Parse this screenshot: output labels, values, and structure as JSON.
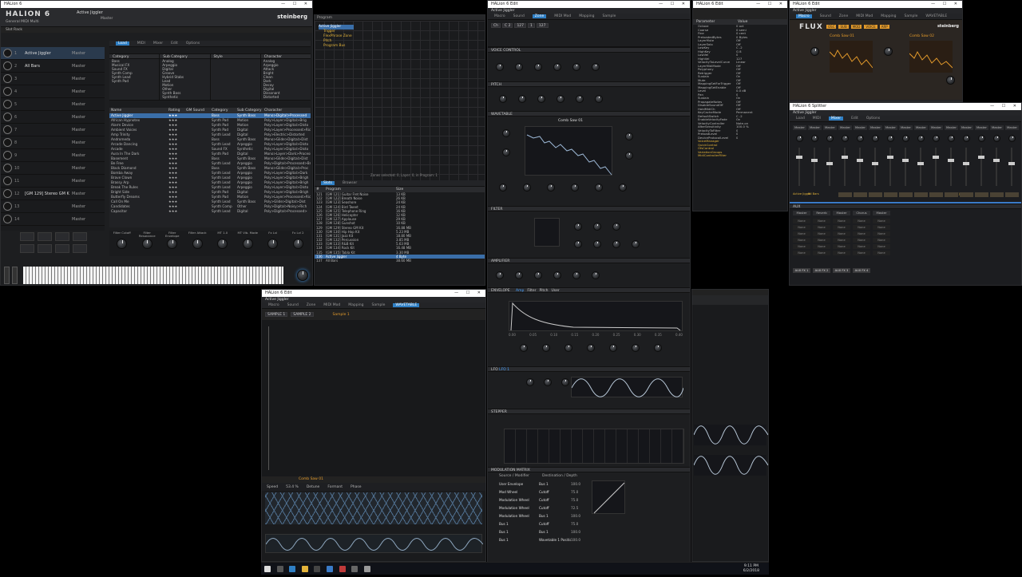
{
  "main": {
    "title": "HALion 6",
    "menu": [
      "Active Jiggler",
      "Master",
      "General MIDI Multi"
    ],
    "brand": "steinberg",
    "logo": "HALION 6",
    "slot_rack_label": "Slot Rack",
    "slots": [
      {
        "num": "1",
        "name": "Active Jiggler"
      },
      {
        "num": "2",
        "name": "All Bars"
      },
      {
        "num": "3",
        "name": ""
      },
      {
        "num": "4",
        "name": ""
      },
      {
        "num": "5",
        "name": ""
      },
      {
        "num": "6",
        "name": ""
      },
      {
        "num": "7",
        "name": ""
      },
      {
        "num": "8",
        "name": ""
      },
      {
        "num": "9",
        "name": ""
      },
      {
        "num": "10",
        "name": ""
      },
      {
        "num": "11",
        "name": ""
      },
      {
        "num": "12",
        "name": "[GM 129] Stereo GM Kit"
      },
      {
        "num": "13",
        "name": ""
      },
      {
        "num": "14",
        "name": ""
      }
    ],
    "output_label": "Master",
    "browser_tabs": [
      "Load",
      "MIDI",
      "Mixer",
      "Edit",
      "Options"
    ],
    "filter_headers": [
      "Category",
      "Sub Category",
      "Style",
      "Character"
    ],
    "categories": [
      "Bass",
      "Musical FX",
      "Sound FX",
      "Synth Comp",
      "Synth Lead",
      "Synth Pad"
    ],
    "subcategories": [
      "Analog",
      "Arpeggio",
      "Digital",
      "Groove",
      "Hybrid Stabs",
      "Lead",
      "Motion",
      "Other",
      "Synth Bass",
      "Synthetic"
    ],
    "character": [
      "Analog",
      "Arpeggio",
      "Attack",
      "Bright",
      "Clean",
      "Dark",
      "Decay",
      "Digital",
      "Dissonant",
      "Distorted"
    ],
    "result_headers": [
      "Name",
      "Rating",
      "GM Sound",
      "Category",
      "Sub Category",
      "Character"
    ],
    "results": [
      [
        "Active Jiggler",
        "★★★",
        "",
        "Bass",
        "Synth Bass",
        "Mono>Digital>Processed"
      ],
      [
        "African Hypnotex",
        "★★★",
        "",
        "Synth Pad",
        "Motion",
        "Poly>Layer>Digital>Brig"
      ],
      [
        "Alarm Device",
        "★★★",
        "",
        "Synth Pad",
        "Motion",
        "Poly>Layer>Digital>Disto"
      ],
      [
        "Ambient Voices",
        "★★★",
        "",
        "Synth Pad",
        "Digital",
        "Poly>Layer>Processed>Rich"
      ],
      [
        "Amp Trinity",
        "★★★",
        "",
        "Synth Lead",
        "Digital",
        "Poly>Electric>Distorted"
      ],
      [
        "Andromeda",
        "★★★",
        "",
        "Bass",
        "Synth Bass",
        "Mono>Glide>Digital>Dist"
      ],
      [
        "Arcade Dancing",
        "★★★",
        "",
        "Synth Lead",
        "Arpeggio",
        "Poly>Layer>Digital>Disto"
      ],
      [
        "Arcade",
        "★★★",
        "",
        "Sound FX",
        "Synthetic",
        "Poly>Layer>Digital>Disto"
      ],
      [
        "Aura In The Dark",
        "★★★",
        "",
        "Synth Pad",
        "Digital",
        "Mono>Layer>Dark>Processed"
      ],
      [
        "Basement",
        "★★★",
        "",
        "Bass",
        "Synth Bass",
        "Mono>Glide>Digital>Dist"
      ],
      [
        "Be Free",
        "★★★",
        "",
        "Synth Lead",
        "Arpeggio",
        "Poly>Digital>Processed>Brigh"
      ],
      [
        "Black Diamond",
        "★★★",
        "",
        "Bass",
        "Synth Bass",
        "Mono>Glide>Digital>Proc"
      ],
      [
        "Bomba Away",
        "★★★",
        "",
        "Synth Lead",
        "Arpeggio",
        "Poly>Layer>Digital>Dark"
      ],
      [
        "Brave Clown",
        "★★★",
        "",
        "Synth Lead",
        "Arpeggio",
        "Poly>Layer>Digital>Brigh"
      ],
      [
        "Brassy Arp",
        "★★★",
        "",
        "Synth Lead",
        "Arpeggio",
        "Poly>Layer>Digital>Brigh"
      ],
      [
        "Break The Rules",
        "★★★",
        "",
        "Synth Lead",
        "Arpeggio",
        "Poly>Layer>Digital>Disto"
      ],
      [
        "Bright Side",
        "★★★",
        "",
        "Synth Pad",
        "Digital",
        "Poly>Layer>Digital>Brigh"
      ],
      [
        "Butterfly Dreams",
        "★★★",
        "",
        "Synth Pad",
        "Motion",
        "Poly>Layer>Processed>Rich"
      ],
      [
        "Call On Me",
        "★★★",
        "",
        "Synth Lead",
        "Synth Bass",
        "Poly>Glide>Digital>Dist"
      ],
      [
        "Candidates",
        "★★★",
        "",
        "Synth Comp",
        "Other",
        "Poly>Digital>Noisy>Rich"
      ],
      [
        "Capacitor",
        "★★★",
        "",
        "Synth Lead",
        "Digital",
        "Poly>Digital>Processed>"
      ]
    ],
    "quick_controls": [
      "Filter Cutoff",
      "Filter Resonance",
      "Filter Envelope",
      "Filter Attack",
      "MT 1.0",
      "MT Vib. Mode",
      "Fx Lvl",
      "Fx Lvl 2"
    ]
  },
  "program_tree": {
    "tab_label": "Program",
    "tree": [
      "Active Jiggler",
      "Trigger",
      "FlexPhrase Zone",
      "Pitch",
      "Program Bus"
    ],
    "status": "Zones selected: 0, Layer: 0, in Program: 1",
    "list_tabs": [
      "Slots",
      "Browser"
    ],
    "list_headers": [
      "#",
      "Program",
      "Size"
    ],
    "programs": [
      [
        "121",
        "[GM 121] Guitar Fret Noise",
        "13 KB"
      ],
      [
        "122",
        "[GM 122] Breath Noise",
        "26 KB"
      ],
      [
        "123",
        "[GM 123] Seashore",
        "24 KB"
      ],
      [
        "124",
        "[GM 124] Bird Tweet",
        "24 KB"
      ],
      [
        "125",
        "[GM 125] Telephone Ring",
        "16 KB"
      ],
      [
        "126",
        "[GM 126] Helicopter",
        "12 KB"
      ],
      [
        "127",
        "[GM 127] Applause",
        "29 KB"
      ],
      [
        "128",
        "[GM 128] Gunshot",
        "10 KB"
      ],
      [
        "129",
        "[GM 129] Stereo GM Kit",
        "16.88 MB"
      ],
      [
        "130",
        "[GM 130] Hip Hop Kit",
        "5.23 MB"
      ],
      [
        "131",
        "[GM 131] Jazz Kit",
        "18.80 MB"
      ],
      [
        "132",
        "[GM 132] Percussion",
        "3.85 MB"
      ],
      [
        "133",
        "[GM 133] R&B Kit",
        "5.63 MB"
      ],
      [
        "134",
        "[GM 134] Rock Kit",
        "16.48 MB"
      ],
      [
        "135",
        "[GM 135] Tabla Kit",
        "3.30 MB"
      ],
      [
        "136",
        "Active Jiggler",
        "4 Byte"
      ],
      [
        "137",
        "All Bars",
        "38.60 MB"
      ]
    ]
  },
  "edit": {
    "title": "HALion 6 Edit",
    "tabs": [
      "Macro",
      "Sound",
      "Zone",
      "MIDI Mod",
      "Mapping",
      "Sample"
    ],
    "active_tab": "Zone",
    "program": "Active Jiggler",
    "sections": [
      "VOICE CONTROL",
      "PITCH",
      "WAVETABLE",
      "FILTER",
      "AMPLIFIER",
      "ENVELOPE",
      "LFO",
      "STEPPER",
      "MODULATION MATRIX"
    ],
    "wavetable_name": "Comb Saw 01",
    "env_labels": [
      "Amp",
      "Filter",
      "Pitch",
      "User"
    ],
    "env_ticks": [
      "0.00",
      "0.05",
      "0.10",
      "0.15",
      "0.20",
      "0.25",
      "0.30",
      "0.35",
      "0.40"
    ],
    "lfo_label": "LFO 1",
    "matrix_headers": [
      "Source / Modifier",
      "Destination / Depth"
    ],
    "matrix_sources": [
      "User Envelope",
      "Mod Wheel",
      "Modulation Wheel",
      "Modulation Wheel",
      "Modulation Wheel",
      "Bus 1",
      "Bus 1",
      "Bus 1"
    ],
    "matrix_dests": [
      "Bus 1",
      "Cutoff",
      "Cutoff",
      "Cutoff",
      "Bus 1",
      "Cutoff",
      "Bus 1",
      "Wavetable 1 Position"
    ],
    "matrix_values": [
      "100.0",
      "75.0",
      "75.0",
      "72.5",
      "100.0",
      "75.0",
      "100.0",
      "100.0"
    ]
  },
  "params": {
    "title": "HALion 6 Edit",
    "tabs": [
      "Macro",
      "Sound",
      "Zone",
      "MIDI Mod",
      "Mapping",
      "Sample"
    ],
    "headers": [
      "Parameter",
      "Value"
    ],
    "rows": [
      [
        "Octave",
        "0 oct"
      ],
      [
        "Coarse",
        "0 semi"
      ],
      [
        "Fine",
        "0 cent"
      ],
      [
        "PreloadedBytes",
        "0 Bytes"
      ],
      [
        "LayerMute",
        "Off"
      ],
      [
        "LayerSolo",
        "Off"
      ],
      [
        "LowKey",
        "C -2"
      ],
      [
        "HighKey",
        "G 8"
      ],
      [
        "LowVel",
        "0"
      ],
      [
        "HighVel",
        "127"
      ],
      [
        "VelocityToLevelCurve",
        "Linear"
      ],
      [
        "LayerMidiMode",
        "Off"
      ],
      [
        "Polyphony",
        "Off"
      ],
      [
        "Retrigger",
        "Off"
      ],
      [
        "Sustain",
        "On"
      ],
      [
        "Mute",
        "Off"
      ],
      [
        "MappingSetForTrigger",
        "Off"
      ],
      [
        "MappingSetEnable",
        "Off"
      ],
      [
        "Level",
        "0.0 dB"
      ],
      [
        "Pan",
        "0"
      ],
      [
        "Sustain",
        "On"
      ],
      [
        "PropagateNotes",
        "Off"
      ],
      [
        "DisableSoundOff",
        "Off"
      ],
      [
        "HoldMidiCh",
        "Off"
      ],
      [
        "KeyCacheMode",
        "Permanent"
      ],
      [
        "DefaultSwitch",
        "C -2"
      ],
      [
        "EnableVelocityFade",
        "On"
      ],
      [
        "VelocityController",
        "Note-on"
      ],
      [
        "AfterSensitivity",
        "100.0 %"
      ],
      [
        "VelocityToFilter",
        "0"
      ],
      [
        "PreloadLevel",
        "0"
      ],
      [
        "DeviceProtocolLevel",
        "0"
      ]
    ],
    "folders": [
      "VoiceManager",
      "QuickControl",
      "OfsControl",
      "VariationGroups",
      "MidiControllerFilter"
    ]
  },
  "flux": {
    "title": "HALion 6 Edit",
    "tabs": [
      "Macro",
      "Sound",
      "Zone",
      "MIDI Mod",
      "Mapping",
      "Sample",
      "WAVETABLE"
    ],
    "program": "Active Jiggler",
    "logo": "FLUX",
    "brand": "steinberg",
    "osc1": "Comb Saw 01",
    "osc2": "Comb Saw 02",
    "section_tags": [
      "OSC",
      "SUB",
      "MOD",
      "VOICE",
      "ARP"
    ]
  },
  "splitter": {
    "title": "HALion 6 Splitter",
    "program": "Active Jiggler",
    "tabs": [
      "Load",
      "MIDI",
      "Mixer",
      "Edit",
      "Options"
    ],
    "strip_label": "Master",
    "channel_names": [
      "Active Jiggler",
      "All Bars",
      "[GM 129]"
    ],
    "aux_label": "AUX",
    "aux_strips": [
      "Master",
      "Reverb",
      "Master",
      "Chorus",
      "Master"
    ],
    "aux_names": [
      "AUX FX 1",
      "AUX FX 2",
      "AUX FX 3",
      "AUX FX 4"
    ],
    "none": "None"
  },
  "sample": {
    "title": "HALion 6 Edit",
    "program": "Active Jiggler",
    "tabs": [
      "Macro",
      "Sound",
      "Zone",
      "MIDI Mod",
      "Mapping",
      "Sample",
      "WAVETABLE"
    ],
    "sub_tabs": [
      "SAMPLE 1",
      "SAMPLE 2"
    ],
    "zone_label": "Sample 1",
    "wave_label": "Comb Saw 01",
    "footer": [
      "Speed",
      "53.4 %",
      "Detune",
      "Formant",
      "Phase"
    ]
  },
  "taskbar": {
    "time": "9:11 PM",
    "date": "6/2/2018"
  },
  "colors": {
    "accent": "#2f7fc4",
    "orange": "#e39a2b",
    "panel": "#1d1e20"
  }
}
